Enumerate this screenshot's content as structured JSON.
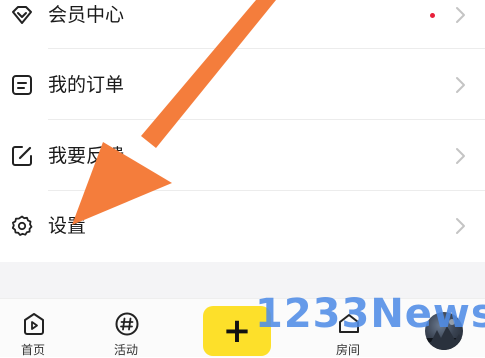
{
  "menu": {
    "items": [
      {
        "label": "会员中心",
        "icon": "diamond-icon",
        "has_dot": true
      },
      {
        "label": "我的订单",
        "icon": "order-list-icon",
        "has_dot": false
      },
      {
        "label": "我要反馈",
        "icon": "feedback-edit-icon",
        "has_dot": false
      },
      {
        "label": "设置",
        "icon": "gear-icon",
        "has_dot": false
      }
    ]
  },
  "tabbar": {
    "tabs": [
      {
        "label": "首页",
        "icon": "home-play-icon"
      },
      {
        "label": "活动",
        "icon": "hashtag-icon"
      },
      {
        "label": "",
        "icon": "plus-icon"
      },
      {
        "label": "房间",
        "icon": "room-icon"
      }
    ],
    "plus_label": "+"
  },
  "watermark": {
    "text": "1233News"
  },
  "colors": {
    "accent_yellow": "#fde02a",
    "arrow_orange": "#f47d3c",
    "badge_red": "#e8203a",
    "watermark_blue": "#508ce6"
  }
}
